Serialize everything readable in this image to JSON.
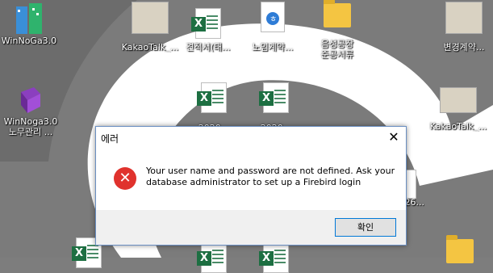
{
  "desktop": {
    "icons": [
      {
        "label": "WinNoGa3.0"
      },
      {
        "label": "KakaoTalk_..."
      },
      {
        "label": "견적서(태..."
      },
      {
        "label": "노임계약..."
      },
      {
        "label": "음성공장"
      },
      {
        "label": "준공서류"
      },
      {
        "label": "변경계약..."
      },
      {
        "label": "WinNoga3.0"
      },
      {
        "label": "노무관리 ..."
      },
      {
        "label": "2020..."
      },
      {
        "label": "2020..."
      },
      {
        "label": "KakaoTalk_..."
      },
      {
        "label": "26..."
      }
    ]
  },
  "dialog": {
    "title": "에러",
    "close_symbol": "✕",
    "icon_symbol": "✕",
    "message": "Your user name and password are not defined. Ask your database administrator to set up a Firebird login",
    "ok_label": "확인"
  }
}
